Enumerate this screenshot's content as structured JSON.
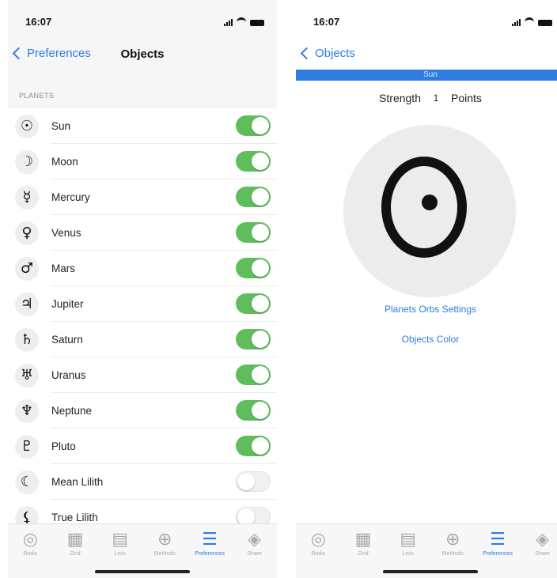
{
  "status": {
    "time": "16:07"
  },
  "left": {
    "back_label": "Preferences",
    "title": "Objects",
    "section": "PLANETS",
    "planets": [
      {
        "symbol": "☉",
        "name": "Sun",
        "enabled": true
      },
      {
        "symbol": "☽",
        "name": "Moon",
        "enabled": true
      },
      {
        "symbol": "☿",
        "name": "Mercury",
        "enabled": true
      },
      {
        "symbol": "♀",
        "name": "Venus",
        "enabled": true
      },
      {
        "symbol": "♂",
        "name": "Mars",
        "enabled": true
      },
      {
        "symbol": "♃",
        "name": "Jupiter",
        "enabled": true
      },
      {
        "symbol": "♄",
        "name": "Saturn",
        "enabled": true
      },
      {
        "symbol": "♅",
        "name": "Uranus",
        "enabled": true
      },
      {
        "symbol": "♆",
        "name": "Neptune",
        "enabled": true
      },
      {
        "symbol": "♇",
        "name": "Pluto",
        "enabled": true
      },
      {
        "symbol": "☾",
        "name": "Mean Lilith",
        "enabled": false
      },
      {
        "symbol": "⚸",
        "name": "True Lilith",
        "enabled": false
      }
    ]
  },
  "right": {
    "back_label": "Objects",
    "band_label": "Sun",
    "strength_label": "Strength",
    "strength_value": "1",
    "points_label": "Points",
    "orbs_link": "Planets Orbs Settings",
    "color_link": "Objects Color"
  },
  "tabs": [
    {
      "icon": "◎",
      "label": "Radix",
      "active": false
    },
    {
      "icon": "▦",
      "label": "Grid",
      "active": false
    },
    {
      "icon": "▤",
      "label": "Lists",
      "active": false
    },
    {
      "icon": "⊕",
      "label": "Methods",
      "active": false
    },
    {
      "icon": "☰",
      "label": "Preferences",
      "active": true
    },
    {
      "icon": "◈",
      "label": "Share",
      "active": false
    }
  ],
  "colors": {
    "accent": "#2f7de1",
    "toggle_on": "#5fbe5b"
  }
}
